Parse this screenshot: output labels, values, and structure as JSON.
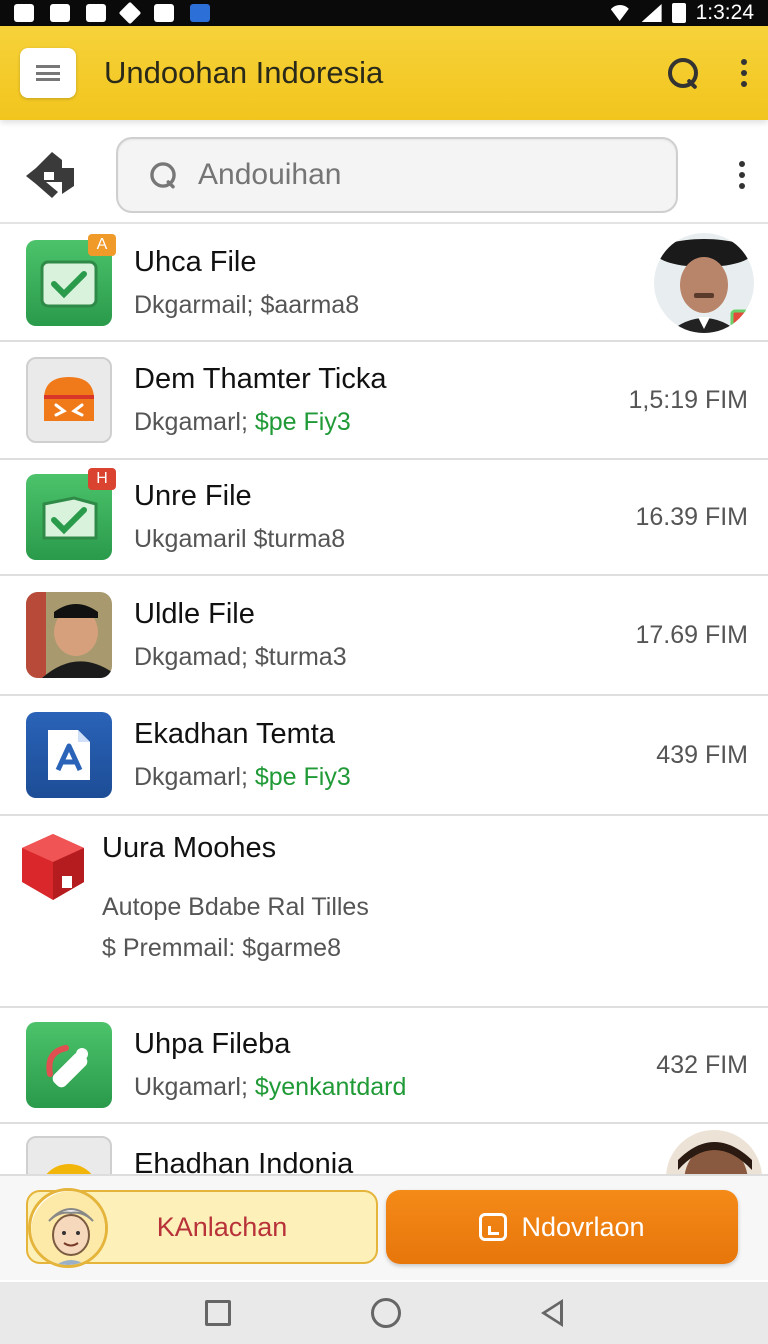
{
  "status_bar": {
    "time": "1:3:24",
    "icons": [
      "add-icon",
      "image-icon",
      "flag-icon",
      "location-icon",
      "game-icon",
      "app-icon",
      "wifi-icon",
      "signal-icon",
      "battery-icon"
    ]
  },
  "app_bar": {
    "title": "Undoohan Indoresia",
    "icons": [
      "menu-icon",
      "search-icon",
      "more-vert-icon"
    ]
  },
  "search": {
    "placeholder": "Andouihan"
  },
  "items": [
    {
      "title": "Uhca File",
      "sub_a": "Dkgarmail;",
      "sub_b": "$aarma8",
      "sub_b_color": "grey",
      "time": "",
      "icon": "green-file-check-icon",
      "badge": "A",
      "trailing": "person-avatar"
    },
    {
      "title": "Dem Thamter Ticka",
      "sub_a": "Dkgamarl;",
      "sub_b": "$pe Fiy3",
      "sub_b_color": "green",
      "time": "1,5:19 FIM",
      "icon": "orange-ticket-icon"
    },
    {
      "title": "Unre File",
      "sub_a": "Ukgamaril",
      "sub_b": "$turma8",
      "sub_b_color": "grey",
      "time": "16.39 FIM",
      "icon": "green-file-check-icon",
      "badge": "H"
    },
    {
      "title": "Uldle File",
      "sub_a": "Dkgamad;",
      "sub_b": "$turma3",
      "sub_b_color": "grey",
      "time": "17.69 FIM",
      "icon": "person-photo"
    },
    {
      "title": "Ekadhan Temta",
      "sub_a": "Dkgamarl;",
      "sub_b": "$pe Fiy3",
      "sub_b_color": "green",
      "time": "439 FIM",
      "icon": "blue-doc-icon"
    },
    {
      "title": "Uura Moohes",
      "line2": "Autope Bdabe Ral Tilles",
      "line3": "$ Premmail: $garme8",
      "icon": "red-cube-icon"
    },
    {
      "title": "Uhpa Fileba",
      "sub_a": "Ukgamarl;",
      "sub_b": "$yenkantdard",
      "sub_b_color": "green",
      "time": "432 FIM",
      "icon": "green-phone-icon"
    },
    {
      "title": "Ehadhan Indonia",
      "icon": "yellow-circle-icon",
      "trailing": "person-avatar"
    }
  ],
  "bottom_buttons": {
    "left_label": "KAnlachan",
    "right_label": "Ndovrlaon"
  },
  "nav": [
    "square-nav-icon",
    "circle-nav-icon",
    "back-nav-icon"
  ],
  "colors": {
    "app_bar": "#f2c51d",
    "accent_green": "#1f9a36",
    "button_orange": "#e7760b",
    "button_left_text": "#b8323a"
  }
}
